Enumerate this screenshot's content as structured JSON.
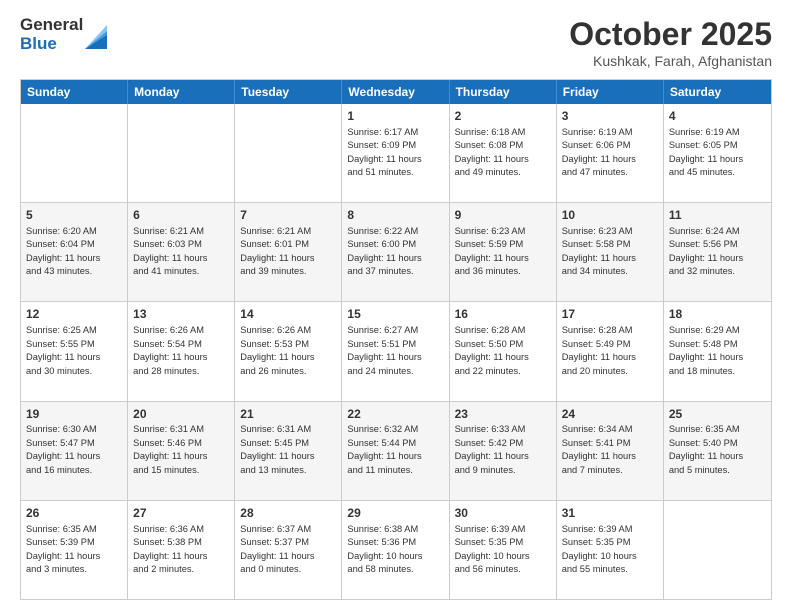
{
  "header": {
    "logo_general": "General",
    "logo_blue": "Blue",
    "month_title": "October 2025",
    "location": "Kushkak, Farah, Afghanistan"
  },
  "weekdays": [
    "Sunday",
    "Monday",
    "Tuesday",
    "Wednesday",
    "Thursday",
    "Friday",
    "Saturday"
  ],
  "rows": [
    [
      {
        "day": "",
        "text": ""
      },
      {
        "day": "",
        "text": ""
      },
      {
        "day": "",
        "text": ""
      },
      {
        "day": "1",
        "text": "Sunrise: 6:17 AM\nSunset: 6:09 PM\nDaylight: 11 hours\nand 51 minutes."
      },
      {
        "day": "2",
        "text": "Sunrise: 6:18 AM\nSunset: 6:08 PM\nDaylight: 11 hours\nand 49 minutes."
      },
      {
        "day": "3",
        "text": "Sunrise: 6:19 AM\nSunset: 6:06 PM\nDaylight: 11 hours\nand 47 minutes."
      },
      {
        "day": "4",
        "text": "Sunrise: 6:19 AM\nSunset: 6:05 PM\nDaylight: 11 hours\nand 45 minutes."
      }
    ],
    [
      {
        "day": "5",
        "text": "Sunrise: 6:20 AM\nSunset: 6:04 PM\nDaylight: 11 hours\nand 43 minutes."
      },
      {
        "day": "6",
        "text": "Sunrise: 6:21 AM\nSunset: 6:03 PM\nDaylight: 11 hours\nand 41 minutes."
      },
      {
        "day": "7",
        "text": "Sunrise: 6:21 AM\nSunset: 6:01 PM\nDaylight: 11 hours\nand 39 minutes."
      },
      {
        "day": "8",
        "text": "Sunrise: 6:22 AM\nSunset: 6:00 PM\nDaylight: 11 hours\nand 37 minutes."
      },
      {
        "day": "9",
        "text": "Sunrise: 6:23 AM\nSunset: 5:59 PM\nDaylight: 11 hours\nand 36 minutes."
      },
      {
        "day": "10",
        "text": "Sunrise: 6:23 AM\nSunset: 5:58 PM\nDaylight: 11 hours\nand 34 minutes."
      },
      {
        "day": "11",
        "text": "Sunrise: 6:24 AM\nSunset: 5:56 PM\nDaylight: 11 hours\nand 32 minutes."
      }
    ],
    [
      {
        "day": "12",
        "text": "Sunrise: 6:25 AM\nSunset: 5:55 PM\nDaylight: 11 hours\nand 30 minutes."
      },
      {
        "day": "13",
        "text": "Sunrise: 6:26 AM\nSunset: 5:54 PM\nDaylight: 11 hours\nand 28 minutes."
      },
      {
        "day": "14",
        "text": "Sunrise: 6:26 AM\nSunset: 5:53 PM\nDaylight: 11 hours\nand 26 minutes."
      },
      {
        "day": "15",
        "text": "Sunrise: 6:27 AM\nSunset: 5:51 PM\nDaylight: 11 hours\nand 24 minutes."
      },
      {
        "day": "16",
        "text": "Sunrise: 6:28 AM\nSunset: 5:50 PM\nDaylight: 11 hours\nand 22 minutes."
      },
      {
        "day": "17",
        "text": "Sunrise: 6:28 AM\nSunset: 5:49 PM\nDaylight: 11 hours\nand 20 minutes."
      },
      {
        "day": "18",
        "text": "Sunrise: 6:29 AM\nSunset: 5:48 PM\nDaylight: 11 hours\nand 18 minutes."
      }
    ],
    [
      {
        "day": "19",
        "text": "Sunrise: 6:30 AM\nSunset: 5:47 PM\nDaylight: 11 hours\nand 16 minutes."
      },
      {
        "day": "20",
        "text": "Sunrise: 6:31 AM\nSunset: 5:46 PM\nDaylight: 11 hours\nand 15 minutes."
      },
      {
        "day": "21",
        "text": "Sunrise: 6:31 AM\nSunset: 5:45 PM\nDaylight: 11 hours\nand 13 minutes."
      },
      {
        "day": "22",
        "text": "Sunrise: 6:32 AM\nSunset: 5:44 PM\nDaylight: 11 hours\nand 11 minutes."
      },
      {
        "day": "23",
        "text": "Sunrise: 6:33 AM\nSunset: 5:42 PM\nDaylight: 11 hours\nand 9 minutes."
      },
      {
        "day": "24",
        "text": "Sunrise: 6:34 AM\nSunset: 5:41 PM\nDaylight: 11 hours\nand 7 minutes."
      },
      {
        "day": "25",
        "text": "Sunrise: 6:35 AM\nSunset: 5:40 PM\nDaylight: 11 hours\nand 5 minutes."
      }
    ],
    [
      {
        "day": "26",
        "text": "Sunrise: 6:35 AM\nSunset: 5:39 PM\nDaylight: 11 hours\nand 3 minutes."
      },
      {
        "day": "27",
        "text": "Sunrise: 6:36 AM\nSunset: 5:38 PM\nDaylight: 11 hours\nand 2 minutes."
      },
      {
        "day": "28",
        "text": "Sunrise: 6:37 AM\nSunset: 5:37 PM\nDaylight: 11 hours\nand 0 minutes."
      },
      {
        "day": "29",
        "text": "Sunrise: 6:38 AM\nSunset: 5:36 PM\nDaylight: 10 hours\nand 58 minutes."
      },
      {
        "day": "30",
        "text": "Sunrise: 6:39 AM\nSunset: 5:35 PM\nDaylight: 10 hours\nand 56 minutes."
      },
      {
        "day": "31",
        "text": "Sunrise: 6:39 AM\nSunset: 5:35 PM\nDaylight: 10 hours\nand 55 minutes."
      },
      {
        "day": "",
        "text": ""
      }
    ]
  ]
}
